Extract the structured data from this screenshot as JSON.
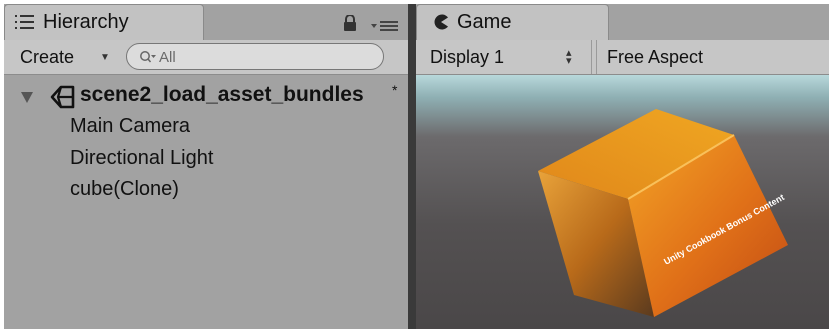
{
  "hierarchy": {
    "tab_label": "Hierarchy",
    "create_label": "Create",
    "create_arrow": "▼",
    "search_placeholder": "All",
    "scene": {
      "name": "scene2_load_asset_bundles",
      "modified_mark": "*",
      "items": [
        "Main Camera",
        "Directional Light",
        "cube(Clone)"
      ]
    }
  },
  "game": {
    "tab_label": "Game",
    "display_label": "Display 1",
    "display_arrow": "▲▼",
    "aspect_label": "Free Aspect",
    "cube_text": "Unity Cookbook Bonus Content"
  }
}
